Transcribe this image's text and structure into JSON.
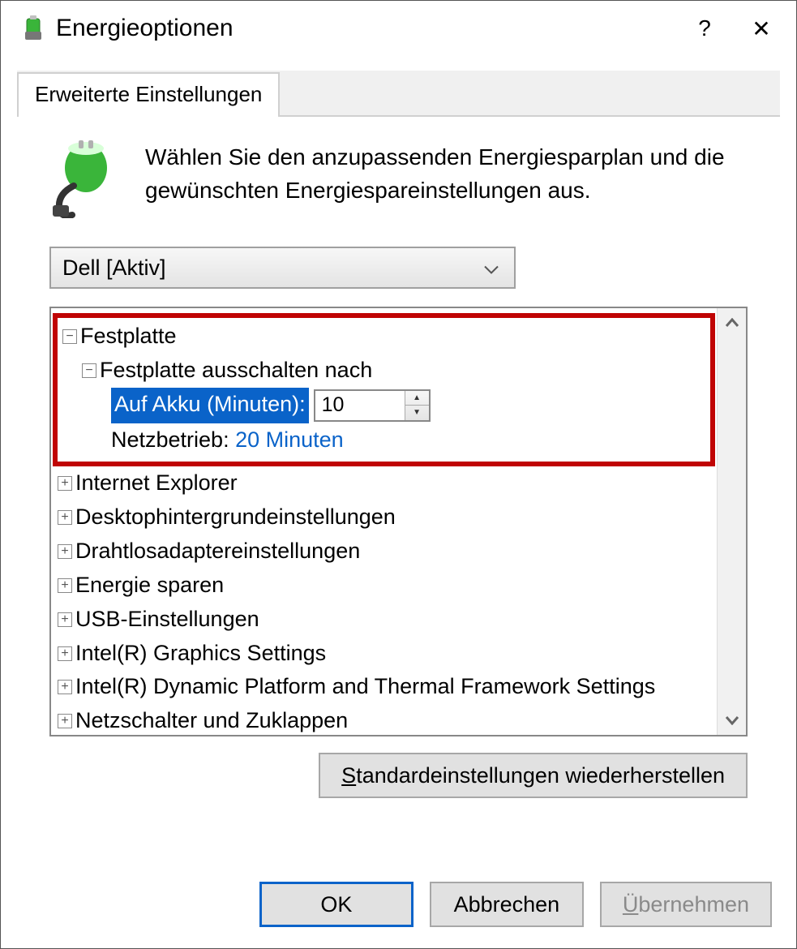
{
  "window": {
    "title": "Energieoptionen",
    "help": "?",
    "close": "✕"
  },
  "tab": {
    "label": "Erweiterte Einstellungen"
  },
  "intro": "Wählen Sie den anzupassenden Energiesparplan und die gewünschten Energiespareinstellungen aus.",
  "plan": {
    "selected": "Dell [Aktiv]"
  },
  "tree": {
    "festplatte": "Festplatte",
    "ausschalten": "Festplatte ausschalten nach",
    "akku_label": "Auf Akku (Minuten):",
    "akku_value": "10",
    "netz_label": "Netzbetrieb:",
    "netz_value": "20 Minuten",
    "items": [
      "Internet Explorer",
      "Desktophintergrundeinstellungen",
      "Drahtlosadaptereinstellungen",
      "Energie sparen",
      "USB-Einstellungen",
      "Intel(R) Graphics Settings",
      "Intel(R) Dynamic Platform and Thermal Framework Settings",
      "Netzschalter und Zuklappen"
    ]
  },
  "buttons": {
    "restore_pre": "S",
    "restore_post": "tandardeinstellungen wiederherstellen",
    "ok": "OK",
    "cancel": "Abbrechen",
    "apply_pre": "Ü",
    "apply_post": "bernehmen"
  }
}
